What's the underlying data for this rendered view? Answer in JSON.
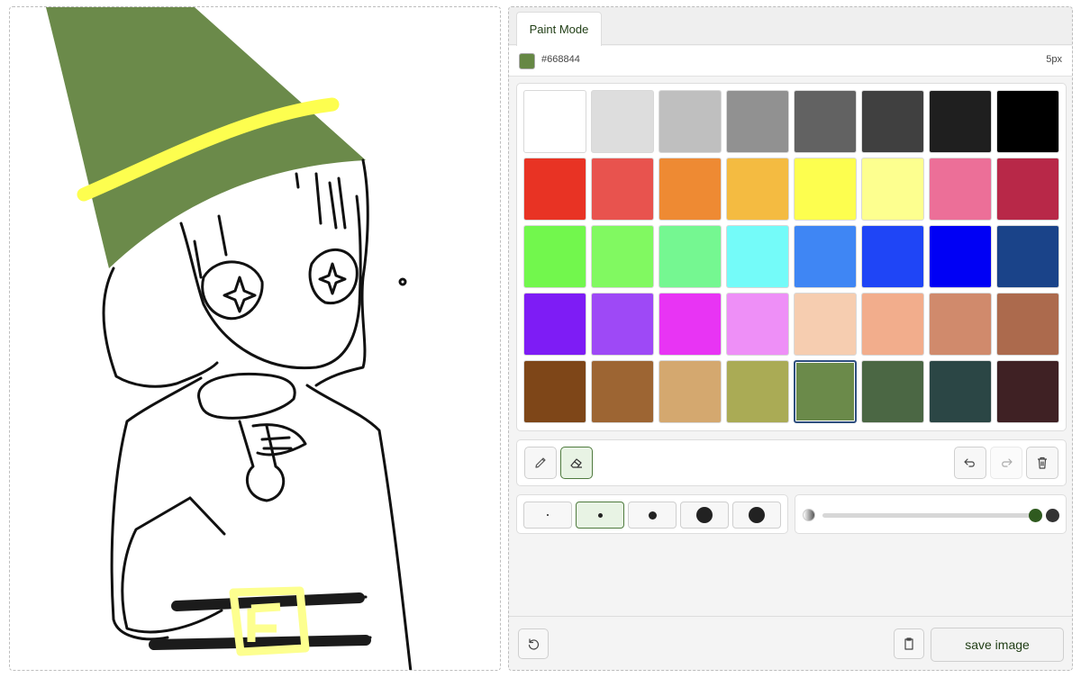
{
  "tab": {
    "label": "Paint Mode"
  },
  "current": {
    "color": "#668844",
    "hex_label": "#668844",
    "size_label": "5px"
  },
  "palette": {
    "selected_index": 36,
    "colors": [
      "#ffffff",
      "#dddddd",
      "#bfbfbf",
      "#919191",
      "#626262",
      "#404040",
      "#1f1f1f",
      "#000000",
      "#e83324",
      "#e8534e",
      "#ee8a33",
      "#f4bb41",
      "#fdfe4f",
      "#fdff8f",
      "#ec6f98",
      "#b82848",
      "#72f74d",
      "#81f961",
      "#75f791",
      "#74fbf9",
      "#3f86f4",
      "#1f45f6",
      "#0000f5",
      "#1a4389",
      "#7e1cf5",
      "#9e49f6",
      "#e834f4",
      "#ee8ff7",
      "#f6cdb0",
      "#f2ad8c",
      "#d08a6c",
      "#ac6a4d",
      "#7e4618",
      "#9d6533",
      "#d4a86f",
      "#aaab55",
      "#6b8a4a",
      "#4b6744",
      "#2b4645",
      "#3f2124"
    ]
  },
  "tools": {
    "pencil_icon": "pencil-icon",
    "eraser_icon": "eraser-icon",
    "undo_icon": "undo-icon",
    "redo_icon": "redo-icon",
    "trash_icon": "trash-icon",
    "active_tool": "eraser"
  },
  "brush_sizes": {
    "active_index": 1,
    "count": 5
  },
  "opacity": {
    "value": 1.0
  },
  "bottom": {
    "save_label": "save image"
  }
}
